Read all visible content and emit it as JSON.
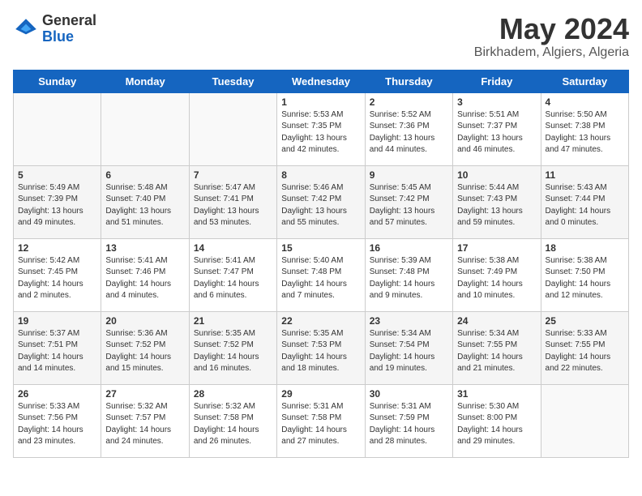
{
  "header": {
    "logo_general": "General",
    "logo_blue": "Blue",
    "month_year": "May 2024",
    "location": "Birkhadem, Algiers, Algeria"
  },
  "days_of_week": [
    "Sunday",
    "Monday",
    "Tuesday",
    "Wednesday",
    "Thursday",
    "Friday",
    "Saturday"
  ],
  "weeks": [
    [
      {
        "day": "",
        "info": ""
      },
      {
        "day": "",
        "info": ""
      },
      {
        "day": "",
        "info": ""
      },
      {
        "day": "1",
        "info": "Sunrise: 5:53 AM\nSunset: 7:35 PM\nDaylight: 13 hours\nand 42 minutes."
      },
      {
        "day": "2",
        "info": "Sunrise: 5:52 AM\nSunset: 7:36 PM\nDaylight: 13 hours\nand 44 minutes."
      },
      {
        "day": "3",
        "info": "Sunrise: 5:51 AM\nSunset: 7:37 PM\nDaylight: 13 hours\nand 46 minutes."
      },
      {
        "day": "4",
        "info": "Sunrise: 5:50 AM\nSunset: 7:38 PM\nDaylight: 13 hours\nand 47 minutes."
      }
    ],
    [
      {
        "day": "5",
        "info": "Sunrise: 5:49 AM\nSunset: 7:39 PM\nDaylight: 13 hours\nand 49 minutes."
      },
      {
        "day": "6",
        "info": "Sunrise: 5:48 AM\nSunset: 7:40 PM\nDaylight: 13 hours\nand 51 minutes."
      },
      {
        "day": "7",
        "info": "Sunrise: 5:47 AM\nSunset: 7:41 PM\nDaylight: 13 hours\nand 53 minutes."
      },
      {
        "day": "8",
        "info": "Sunrise: 5:46 AM\nSunset: 7:42 PM\nDaylight: 13 hours\nand 55 minutes."
      },
      {
        "day": "9",
        "info": "Sunrise: 5:45 AM\nSunset: 7:42 PM\nDaylight: 13 hours\nand 57 minutes."
      },
      {
        "day": "10",
        "info": "Sunrise: 5:44 AM\nSunset: 7:43 PM\nDaylight: 13 hours\nand 59 minutes."
      },
      {
        "day": "11",
        "info": "Sunrise: 5:43 AM\nSunset: 7:44 PM\nDaylight: 14 hours\nand 0 minutes."
      }
    ],
    [
      {
        "day": "12",
        "info": "Sunrise: 5:42 AM\nSunset: 7:45 PM\nDaylight: 14 hours\nand 2 minutes."
      },
      {
        "day": "13",
        "info": "Sunrise: 5:41 AM\nSunset: 7:46 PM\nDaylight: 14 hours\nand 4 minutes."
      },
      {
        "day": "14",
        "info": "Sunrise: 5:41 AM\nSunset: 7:47 PM\nDaylight: 14 hours\nand 6 minutes."
      },
      {
        "day": "15",
        "info": "Sunrise: 5:40 AM\nSunset: 7:48 PM\nDaylight: 14 hours\nand 7 minutes."
      },
      {
        "day": "16",
        "info": "Sunrise: 5:39 AM\nSunset: 7:48 PM\nDaylight: 14 hours\nand 9 minutes."
      },
      {
        "day": "17",
        "info": "Sunrise: 5:38 AM\nSunset: 7:49 PM\nDaylight: 14 hours\nand 10 minutes."
      },
      {
        "day": "18",
        "info": "Sunrise: 5:38 AM\nSunset: 7:50 PM\nDaylight: 14 hours\nand 12 minutes."
      }
    ],
    [
      {
        "day": "19",
        "info": "Sunrise: 5:37 AM\nSunset: 7:51 PM\nDaylight: 14 hours\nand 14 minutes."
      },
      {
        "day": "20",
        "info": "Sunrise: 5:36 AM\nSunset: 7:52 PM\nDaylight: 14 hours\nand 15 minutes."
      },
      {
        "day": "21",
        "info": "Sunrise: 5:35 AM\nSunset: 7:52 PM\nDaylight: 14 hours\nand 16 minutes."
      },
      {
        "day": "22",
        "info": "Sunrise: 5:35 AM\nSunset: 7:53 PM\nDaylight: 14 hours\nand 18 minutes."
      },
      {
        "day": "23",
        "info": "Sunrise: 5:34 AM\nSunset: 7:54 PM\nDaylight: 14 hours\nand 19 minutes."
      },
      {
        "day": "24",
        "info": "Sunrise: 5:34 AM\nSunset: 7:55 PM\nDaylight: 14 hours\nand 21 minutes."
      },
      {
        "day": "25",
        "info": "Sunrise: 5:33 AM\nSunset: 7:55 PM\nDaylight: 14 hours\nand 22 minutes."
      }
    ],
    [
      {
        "day": "26",
        "info": "Sunrise: 5:33 AM\nSunset: 7:56 PM\nDaylight: 14 hours\nand 23 minutes."
      },
      {
        "day": "27",
        "info": "Sunrise: 5:32 AM\nSunset: 7:57 PM\nDaylight: 14 hours\nand 24 minutes."
      },
      {
        "day": "28",
        "info": "Sunrise: 5:32 AM\nSunset: 7:58 PM\nDaylight: 14 hours\nand 26 minutes."
      },
      {
        "day": "29",
        "info": "Sunrise: 5:31 AM\nSunset: 7:58 PM\nDaylight: 14 hours\nand 27 minutes."
      },
      {
        "day": "30",
        "info": "Sunrise: 5:31 AM\nSunset: 7:59 PM\nDaylight: 14 hours\nand 28 minutes."
      },
      {
        "day": "31",
        "info": "Sunrise: 5:30 AM\nSunset: 8:00 PM\nDaylight: 14 hours\nand 29 minutes."
      },
      {
        "day": "",
        "info": ""
      }
    ]
  ]
}
